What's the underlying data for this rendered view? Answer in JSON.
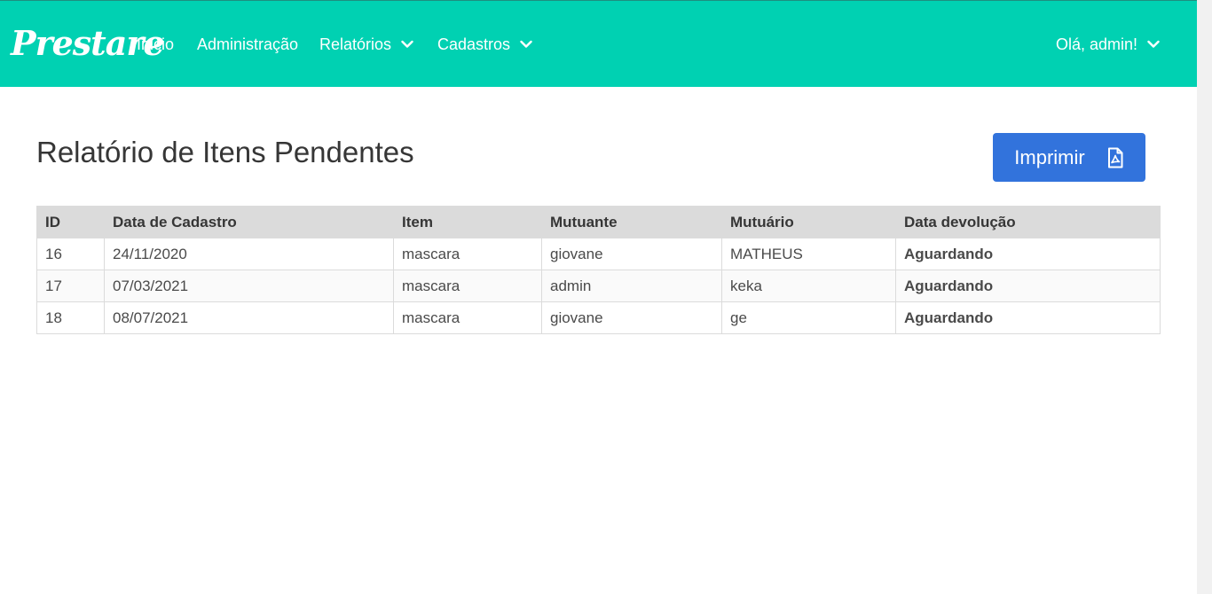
{
  "navbar": {
    "brand": "Prestare",
    "items": [
      {
        "label": "Inicio"
      },
      {
        "label": "Administração"
      },
      {
        "label": "Relatórios"
      },
      {
        "label": "Cadastros"
      }
    ],
    "user_label": "Olá, admin!",
    "background_color": "#00d1b2"
  },
  "page": {
    "title": "Relatório de Itens Pendentes",
    "print_button_label": "Imprimir",
    "print_icon": "file-pdf-icon",
    "button_color": "#3273dc"
  },
  "table": {
    "headers": [
      "ID",
      "Data de Cadastro",
      "Item",
      "Mutuante",
      "Mutuário",
      "Data devolução"
    ],
    "rows": [
      [
        "16",
        "24/11/2020",
        "mascara",
        "giovane",
        "MATHEUS",
        "Aguardando"
      ],
      [
        "17",
        "07/03/2021",
        "mascara",
        "admin",
        "keka",
        "Aguardando"
      ],
      [
        "18",
        "08/07/2021",
        "mascara",
        "giovane",
        "ge",
        "Aguardando"
      ]
    ],
    "status_color": "#f14668"
  }
}
